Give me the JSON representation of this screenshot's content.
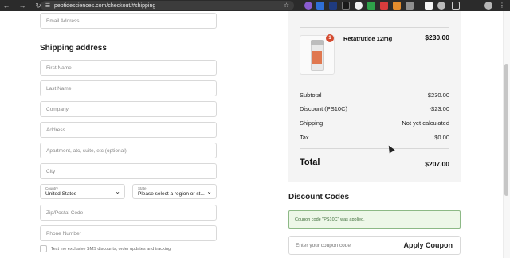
{
  "browser": {
    "url": "peptidesciences.com/checkout/#shipping",
    "back_icon": "arrow-left-icon",
    "forward_icon": "arrow-right-icon",
    "reload_icon": "reload-icon",
    "site_info_icon": "tune-icon",
    "bookmark_icon": "star-icon",
    "extensions": [
      "purple-ext",
      "blue-ext",
      "navy-ext",
      "dark-ext",
      "white-ext",
      "green-ext",
      "red-ext",
      "orange-ext",
      "grey-ext",
      "home-ext",
      "gray-circle-ext",
      "puzzle-ext",
      "profile-avatar"
    ],
    "menu_icon": "kebab-menu-icon"
  },
  "form": {
    "email_placeholder": "Email Address",
    "shipping_title": "Shipping address",
    "first_name_placeholder": "First Name",
    "last_name_placeholder": "Last Name",
    "company_placeholder": "Company",
    "address_placeholder": "Address",
    "apartment_placeholder": "Apartment, atc, suite, etc (optional)",
    "city_placeholder": "City",
    "country_label": "Country",
    "country_value": "United States",
    "state_label": "State",
    "state_value": "Please select a region or st...",
    "zip_placeholder": "Zip/Postal Code",
    "phone_placeholder": "Phone Number",
    "sms_consent": "Text me exclusive SMS discounts, order updates and tracking"
  },
  "summary": {
    "product": {
      "name": "Retatrutide 12mg",
      "price": "$230.00",
      "quantity": "1"
    },
    "rows": [
      {
        "label": "Subtotal",
        "value": "$230.00"
      },
      {
        "label": "Discount (PS10C)",
        "value": "-$23.00"
      },
      {
        "label": "Shipping",
        "value": "Not yet calculated"
      },
      {
        "label": "Tax",
        "value": "$0.00"
      }
    ],
    "total_label": "Total",
    "total_value": "$207.00"
  },
  "discount": {
    "title": "Discount Codes",
    "applied_message": "Coupon code \"PS10C\" was applied.",
    "input_placeholder": "Enter your coupon code",
    "apply_label": "Apply Coupon"
  },
  "colors": {
    "accent_badge": "#d44a2f",
    "success_bg": "#edf7e8",
    "success_border": "#8db986"
  }
}
